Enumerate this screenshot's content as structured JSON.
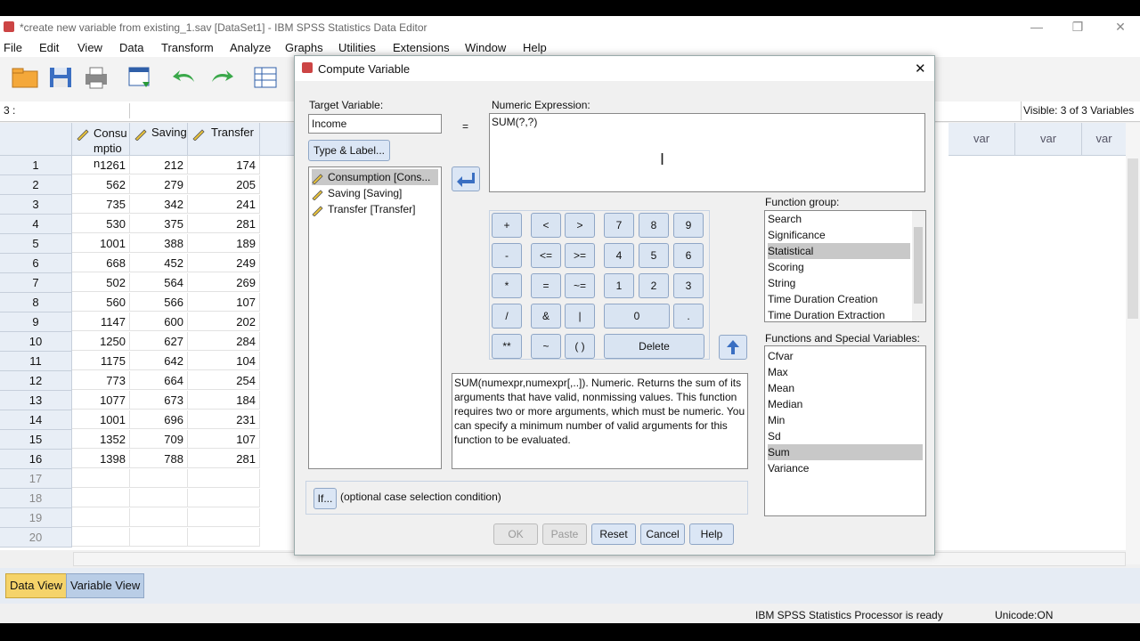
{
  "window": {
    "title": "*create new variable from existing_1.sav [DataSet1] - IBM SPSS Statistics Data Editor",
    "menu": [
      "File",
      "Edit",
      "View",
      "Data",
      "Transform",
      "Analyze",
      "Graphs",
      "Utilities",
      "Extensions",
      "Window",
      "Help"
    ]
  },
  "cellref": {
    "ref": "3 :",
    "visible": "Visible: 3 of 3 Variables"
  },
  "grid": {
    "headers": [
      "Consumption",
      "Saving",
      "Transfer"
    ],
    "header_var": "var",
    "rows": [
      {
        "n": "1",
        "c": "1261",
        "s": "212",
        "t": "174"
      },
      {
        "n": "2",
        "c": "562",
        "s": "279",
        "t": "205"
      },
      {
        "n": "3",
        "c": "735",
        "s": "342",
        "t": "241"
      },
      {
        "n": "4",
        "c": "530",
        "s": "375",
        "t": "281"
      },
      {
        "n": "5",
        "c": "1001",
        "s": "388",
        "t": "189"
      },
      {
        "n": "6",
        "c": "668",
        "s": "452",
        "t": "249"
      },
      {
        "n": "7",
        "c": "502",
        "s": "564",
        "t": "269"
      },
      {
        "n": "8",
        "c": "560",
        "s": "566",
        "t": "107"
      },
      {
        "n": "9",
        "c": "1147",
        "s": "600",
        "t": "202"
      },
      {
        "n": "10",
        "c": "1250",
        "s": "627",
        "t": "284"
      },
      {
        "n": "11",
        "c": "1175",
        "s": "642",
        "t": "104"
      },
      {
        "n": "12",
        "c": "773",
        "s": "664",
        "t": "254"
      },
      {
        "n": "13",
        "c": "1077",
        "s": "673",
        "t": "184"
      },
      {
        "n": "14",
        "c": "1001",
        "s": "696",
        "t": "231"
      },
      {
        "n": "15",
        "c": "1352",
        "s": "709",
        "t": "107"
      },
      {
        "n": "16",
        "c": "1398",
        "s": "788",
        "t": "281"
      },
      {
        "n": "17",
        "c": "",
        "s": "",
        "t": ""
      },
      {
        "n": "18",
        "c": "",
        "s": "",
        "t": ""
      },
      {
        "n": "19",
        "c": "",
        "s": "",
        "t": ""
      },
      {
        "n": "20",
        "c": "",
        "s": "",
        "t": ""
      }
    ]
  },
  "tabs": {
    "data_view": "Data View",
    "variable_view": "Variable View"
  },
  "status": {
    "processor": "IBM SPSS Statistics Processor is ready",
    "unicode": "Unicode:ON"
  },
  "dialog": {
    "title": "Compute Variable",
    "target_label": "Target Variable:",
    "target_value": "Income",
    "equals": "=",
    "type_label_button": "Type & Label...",
    "numeric_expr_label": "Numeric Expression:",
    "numeric_expr_value": "SUM(?,?)",
    "variables": [
      "Consumption [Cons...",
      "Saving [Saving]",
      "Transfer [Transfer]"
    ],
    "keypad": {
      "plus": "+",
      "lt": "<",
      "gt": ">",
      "k7": "7",
      "k8": "8",
      "k9": "9",
      "minus": "-",
      "le": "<=",
      "ge": ">=",
      "k4": "4",
      "k5": "5",
      "k6": "6",
      "mul": "*",
      "eq": "=",
      "ne": "~=",
      "k1": "1",
      "k2": "2",
      "k3": "3",
      "div": "/",
      "and": "&",
      "or": "|",
      "k0": "0",
      "dot": ".",
      "pow": "**",
      "not": "~",
      "paren": "( )",
      "delete": "Delete"
    },
    "function_group_label": "Function group:",
    "function_groups": [
      "Search",
      "Significance",
      "Statistical",
      "Scoring",
      "String",
      "Time Duration Creation",
      "Time Duration Extraction"
    ],
    "functions_label": "Functions and Special Variables:",
    "functions": [
      "Cfvar",
      "Max",
      "Mean",
      "Median",
      "Min",
      "Sd",
      "Sum",
      "Variance"
    ],
    "description": "SUM(numexpr,numexpr[,..]). Numeric. Returns the sum of its arguments that have valid, nonmissing values. This function requires two or more arguments, which must be numeric. You can specify a minimum number of valid arguments for this function to be evaluated.",
    "if_button": "If...",
    "if_text": "(optional case selection condition)",
    "ok": "OK",
    "paste": "Paste",
    "reset": "Reset",
    "cancel": "Cancel",
    "help": "Help"
  },
  "colors": {
    "selection": "#c8c8c8",
    "button_bg": "#d9e4f2",
    "grid_header": "#e8eef6",
    "active_tab": "#f5d36a"
  }
}
